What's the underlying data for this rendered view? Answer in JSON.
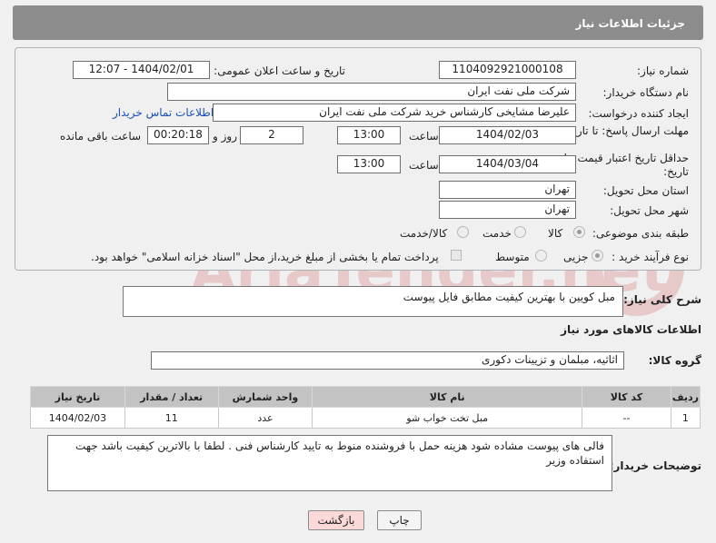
{
  "header": {
    "title": "جزئیات اطلاعات نیاز"
  },
  "labels": {
    "need_number": "شماره نیاز:",
    "announce_datetime": "تاریخ و ساعت اعلان عمومی:",
    "buyer_org": "نام دستگاه خریدار:",
    "requester": "ایجاد کننده درخواست:",
    "contact_info": "اطلاعات تماس خریدار",
    "reply_deadline": "مهلت ارسال پاسخ: تا تاریخ:",
    "hour": "ساعت",
    "day_and": "روز و",
    "time_remaining": "ساعت باقی مانده",
    "price_validity": "حداقل تاریخ اعتبار قیمت: تا تاریخ:",
    "delivery_province": "استان محل تحویل:",
    "delivery_city": "شهر محل تحویل:",
    "category": "طبقه بندی موضوعی:",
    "purchase_type": "نوع فرآیند خرید :",
    "need_desc": "شرح کلی نیاز:",
    "goods_info": "اطلاعات کالاهای مورد نیاز",
    "goods_group": "گروه کالا:",
    "buyer_notes": "توضیحات خریدار:"
  },
  "fields": {
    "need_number": "1104092921000108",
    "announce_datetime": "1404/02/01 - 12:07",
    "buyer_org": "شرکت ملی نفت ایران",
    "requester": "علیرضا مشایخی کارشناس خرید  شرکت ملی نفت ایران",
    "reply_date": "1404/02/03",
    "reply_time": "13:00",
    "reply_days": "2",
    "remaining_time": "00:20:18",
    "price_date": "1404/03/04",
    "price_time": "13:00",
    "province": "تهران",
    "city": "تهران",
    "need_desc": "مبل کویین با بهترین کیفیت مطابق فایل پیوست",
    "goods_group": "اثاثیه، مبلمان و تزیینات دکوری",
    "buyer_notes": "فالی های پیوست مشاده شود هزینه حمل با فروشنده منوط به تایید کارشناس فنی . لطفا با بالاترین کیفیت باشد جهت استفاده وزیر"
  },
  "category_options": [
    "کالا",
    "خدمت",
    "کالا/خدمت"
  ],
  "purchase_options": [
    "جزیی",
    "متوسط"
  ],
  "payment_note": "پرداخت تمام یا بخشی از مبلغ خرید،از محل \"اسناد خزانه اسلامی\" خواهد بود.",
  "table": {
    "headers": [
      "ردیف",
      "کد کالا",
      "نام کالا",
      "واحد شمارش",
      "تعداد / مقدار",
      "تاریخ نیاز"
    ],
    "rows": [
      [
        "1",
        "--",
        "مبل تخت خواب شو",
        "عدد",
        "11",
        "1404/02/03"
      ]
    ]
  },
  "buttons": {
    "print": "چاپ",
    "back": "بازگشت"
  },
  "watermark": "AriaTender.net"
}
